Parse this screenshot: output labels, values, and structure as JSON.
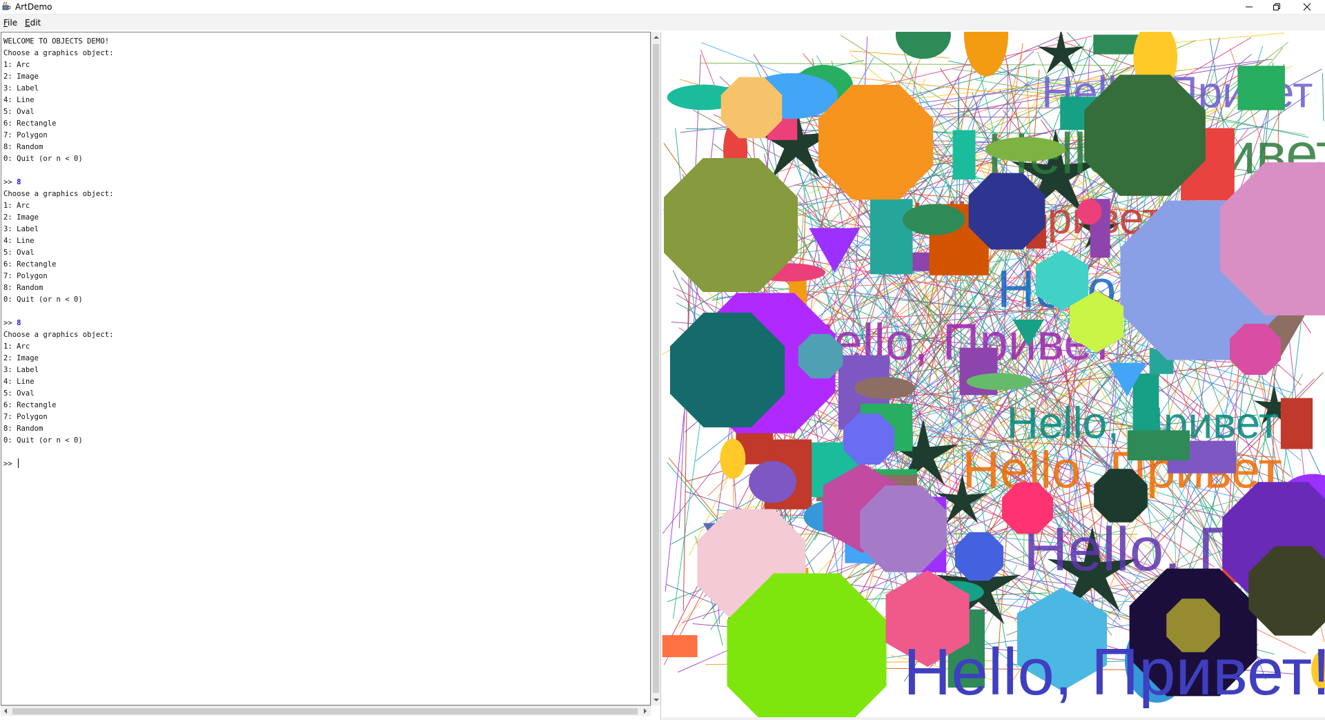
{
  "window": {
    "title": "ArtDemo",
    "icon": "java-cup-icon",
    "controls": [
      "minimize-icon",
      "restore-icon",
      "close-icon"
    ]
  },
  "menu": {
    "file": {
      "mnemonic": "F",
      "rest": "ile"
    },
    "edit": {
      "mnemonic": "E",
      "rest": "dit"
    }
  },
  "console": {
    "lines": [
      {
        "text": "WELCOME TO OBJECTS DEMO!"
      },
      {
        "text": "Choose a graphics object:"
      },
      {
        "text": "1: Arc"
      },
      {
        "text": "2: Image"
      },
      {
        "text": "3: Label"
      },
      {
        "text": "4: Line"
      },
      {
        "text": "5: Oval"
      },
      {
        "text": "6: Rectangle"
      },
      {
        "text": "7: Polygon"
      },
      {
        "text": "8: Random"
      },
      {
        "text": "0: Quit (or n < 0)"
      },
      {
        "text": ""
      },
      {
        "prompt": ">> ",
        "input": "8"
      },
      {
        "text": "Choose a graphics object:"
      },
      {
        "text": "1: Arc"
      },
      {
        "text": "2: Image"
      },
      {
        "text": "3: Label"
      },
      {
        "text": "4: Line"
      },
      {
        "text": "5: Oval"
      },
      {
        "text": "6: Rectangle"
      },
      {
        "text": "7: Polygon"
      },
      {
        "text": "8: Random"
      },
      {
        "text": "0: Quit (or n < 0)"
      },
      {
        "text": ""
      },
      {
        "prompt": ">> ",
        "input": "8"
      },
      {
        "text": "Choose a graphics object:"
      },
      {
        "text": "1: Arc"
      },
      {
        "text": "2: Image"
      },
      {
        "text": "3: Label"
      },
      {
        "text": "4: Line"
      },
      {
        "text": "5: Oval"
      },
      {
        "text": "6: Rectangle"
      },
      {
        "text": "7: Polygon"
      },
      {
        "text": "8: Random"
      },
      {
        "text": "0: Quit (or n < 0)"
      },
      {
        "text": ""
      },
      {
        "prompt": ">> ",
        "input": "",
        "caret": true
      }
    ],
    "input_color": "#1a1adc"
  },
  "canvas": {
    "label_texts": [
      "Hello, Привет",
      "Hello, Привет",
      "Hello, Привет",
      "Hello, Привет",
      "Hello, Привет",
      "Hello, Привет",
      "Hello, Привет",
      "Hello, Привет"
    ],
    "bottom_label": "Hello, Привет!"
  }
}
